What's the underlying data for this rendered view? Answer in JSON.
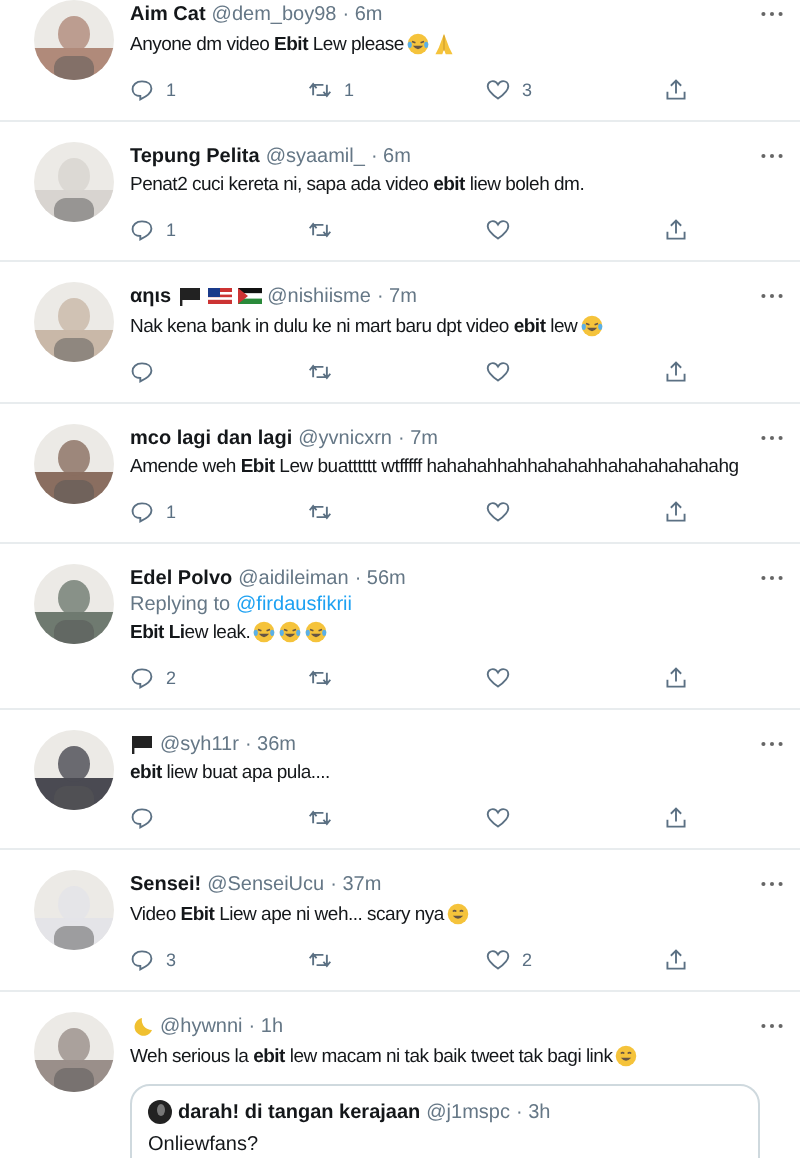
{
  "tweets": [
    {
      "name": "Aim Cat",
      "handle": "@dem_boy98",
      "time": "· 6m",
      "text": "Anyone dm video **Ebit** Lew please",
      "emoji": [
        {
          "kind": "laugh"
        },
        {
          "kind": "pray"
        }
      ],
      "counts": {
        "reply": "1",
        "retweet": "1",
        "like": "3"
      }
    },
    {
      "name": "Tepung Pelita",
      "handle": "@syaamil_",
      "time": "· 6m",
      "text": "Penat2 cuci kereta ni, sapa ada video **ebit** liew boleh dm.",
      "counts": {
        "reply": "1"
      }
    },
    {
      "name": "αηιѕ",
      "name_icons": [
        {
          "kind": "black-flag"
        },
        {
          "kind": "malaysia-flag"
        },
        {
          "kind": "palestine-flag"
        }
      ],
      "handle": "@nishiisme",
      "time": "· 7m",
      "text": "Nak kena bank in dulu ke ni mart baru dpt video **ebit** lew",
      "emoji": [
        {
          "kind": "laugh"
        }
      ]
    },
    {
      "name": "mco lagi dan lagi",
      "handle": "@yvnicxrn",
      "time": "· 7m",
      "text": "Amende weh **Ebit** Lew buatttttt wtfffff hahahahhahhahahahhahahahahahahg",
      "counts": {
        "reply": "1"
      }
    },
    {
      "name": "Edel Polvo",
      "handle": "@aidileiman",
      "time": "· 56m",
      "replying_label": "Replying to",
      "replying_to": "@firdausfikrii",
      "text": "**Ebit Li**ew leak.",
      "emoji": [
        {
          "kind": "laugh"
        },
        {
          "kind": "laugh"
        },
        {
          "kind": "laugh"
        }
      ],
      "counts": {
        "reply": "2"
      }
    },
    {
      "name_icons": [
        {
          "kind": "black-flag"
        }
      ],
      "handle": "@syh11r",
      "time": "· 36m",
      "text": "**ebit** liew buat apa pula...."
    },
    {
      "name": "Sensei!",
      "handle": "@SenseiUcu",
      "time": "· 37m",
      "text": "Video **Ebit** Liew ape ni weh... scary nya",
      "emoji": [
        {
          "kind": "smile"
        }
      ],
      "counts": {
        "reply": "3",
        "like": "2"
      }
    },
    {
      "name_icons": [
        {
          "kind": "moon"
        }
      ],
      "handle": "@hywnni",
      "time": "· 1h",
      "text": "Weh serious la **ebit** lew macam ni tak baik tweet tak bagi link",
      "emoji": [
        {
          "kind": "smile"
        }
      ],
      "quote": {
        "name": "darah! di tangan kerajaan",
        "handle": "@j1mspc",
        "time": "· 3h",
        "text": "Onliewfans?"
      }
    }
  ]
}
